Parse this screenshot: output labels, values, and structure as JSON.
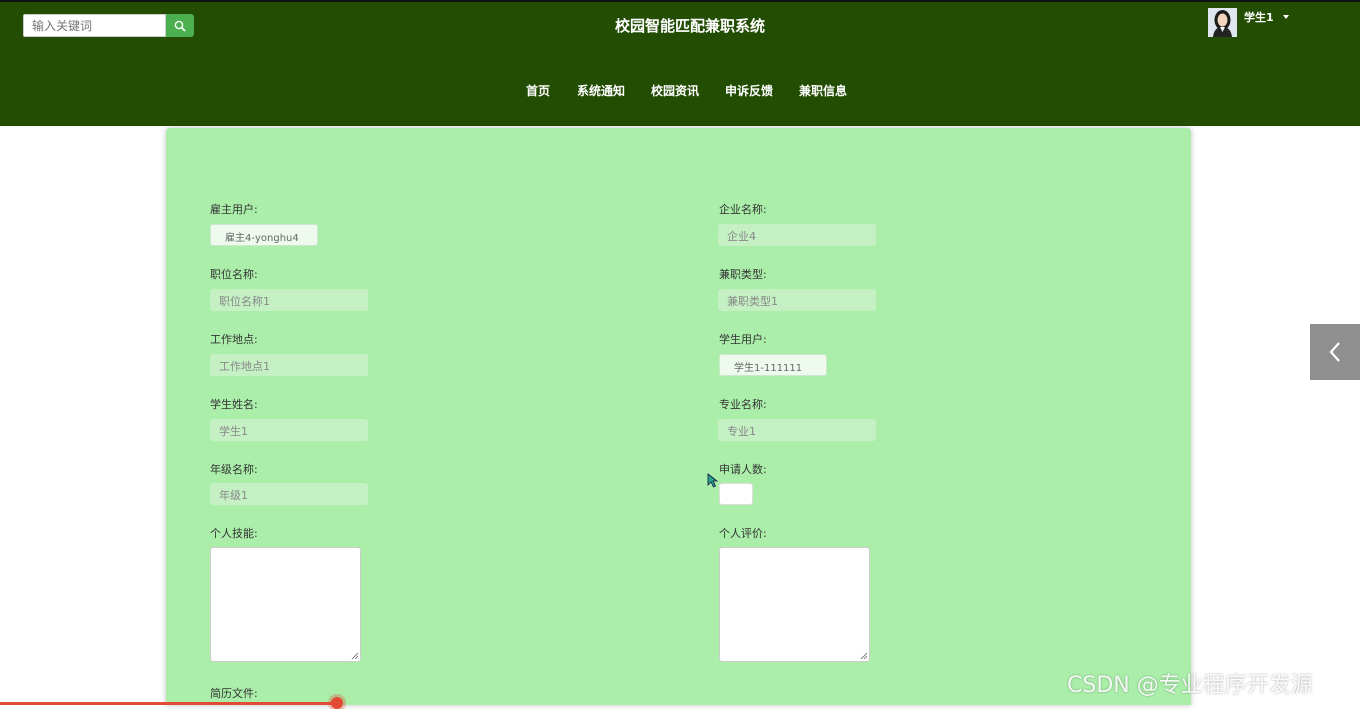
{
  "header": {
    "search_placeholder": "输入关键词",
    "site_title": "校园智能匹配兼职系统",
    "user_name": "学生1"
  },
  "nav": [
    "首页",
    "系统通知",
    "校园资讯",
    "申诉反馈",
    "兼职信息"
  ],
  "form": {
    "employer_user": {
      "label": "雇主用户:",
      "value": "雇主4-yonghu4"
    },
    "company_name": {
      "label": "企业名称:",
      "value": "企业4"
    },
    "position_name": {
      "label": "职位名称:",
      "value": "职位名称1"
    },
    "job_type": {
      "label": "兼职类型:",
      "value": "兼职类型1"
    },
    "work_location": {
      "label": "工作地点:",
      "value": "工作地点1"
    },
    "student_user": {
      "label": "学生用户:",
      "value": "学生1-111111"
    },
    "student_name": {
      "label": "学生姓名:",
      "value": "学生1"
    },
    "major_name": {
      "label": "专业名称:",
      "value": "专业1"
    },
    "grade_name": {
      "label": "年级名称:",
      "value": "年级1"
    },
    "applicants": {
      "label": "申请人数:",
      "value": ""
    },
    "personal_skills": {
      "label": "个人技能:"
    },
    "personal_evaluation": {
      "label": "个人评价:"
    },
    "resume_file": {
      "label": "简历文件:"
    }
  },
  "watermark": "CSDN @专业程序开发源",
  "colors": {
    "header_bg": "#224d03",
    "panel_bg": "#aaeeaa",
    "search_btn": "#4caf50"
  }
}
